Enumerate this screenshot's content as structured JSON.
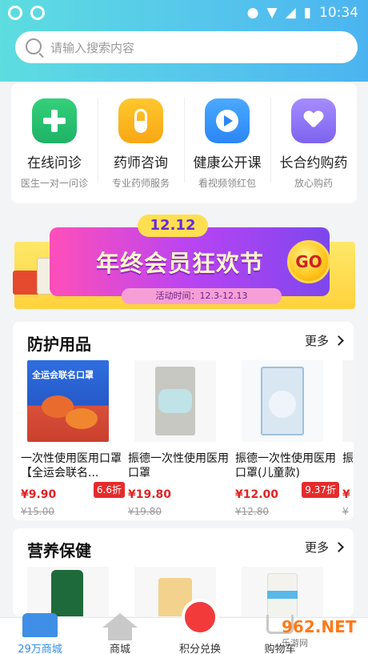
{
  "status_bar": {
    "time": "10:34"
  },
  "search": {
    "placeholder": "请输入搜索内容"
  },
  "services": [
    {
      "title": "在线问诊",
      "subtitle": "医生一对一问诊",
      "icon": "plus-cross-icon"
    },
    {
      "title": "药师咨询",
      "subtitle": "专业药师服务",
      "icon": "pill-icon"
    },
    {
      "title": "健康公开课",
      "subtitle": "看视频领红包",
      "icon": "play-icon"
    },
    {
      "title": "长合约购药",
      "subtitle": "放心购药",
      "icon": "handshake-heart-icon"
    }
  ],
  "banner": {
    "date": "12.12",
    "title": "年终会员狂欢节",
    "subtitle": "活动时间：12.3-12.13",
    "go_label": "GO"
  },
  "section_protect": {
    "title": "防护用品",
    "more": "更多",
    "products": [
      {
        "name": "一次性使用医用口罩【全运会联名...",
        "price": "¥9.90",
        "badge": "6.6折",
        "original": "¥15.00",
        "image_text": "全运会联名口罩"
      },
      {
        "name": "振德一次性使用医用口罩",
        "price": "¥19.80",
        "badge": "",
        "original": "¥19.80"
      },
      {
        "name": "振德一次性使用医用口罩(儿童款)",
        "price": "¥12.00",
        "badge": "9.37折",
        "original": "¥12.80"
      },
      {
        "name": "振",
        "price": "¥",
        "badge": "",
        "original": "¥"
      }
    ]
  },
  "section_health": {
    "title": "营养保健",
    "more": "更多"
  },
  "nav": {
    "items": [
      {
        "label": "29万商城"
      },
      {
        "label": "商城"
      },
      {
        "label": "积分兑换"
      },
      {
        "label": "购物车"
      }
    ],
    "active": 0
  },
  "watermark": {
    "brand": "962.NET",
    "sub": "乐游网"
  },
  "colors": {
    "accent": "#2f8ff0",
    "price": "#e02424",
    "header_start": "#5ddde0",
    "header_end": "#4bb4f0"
  }
}
